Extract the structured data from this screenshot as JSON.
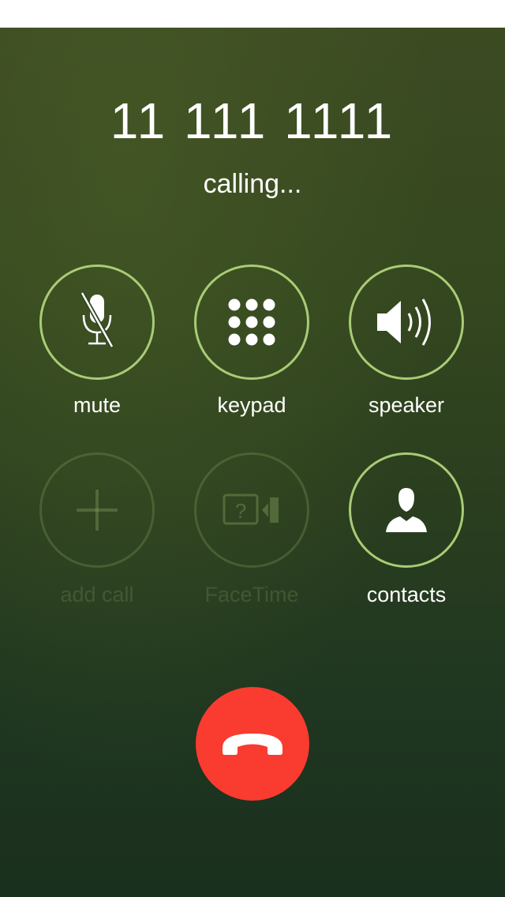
{
  "call": {
    "number": "11 111 1111",
    "status": "calling..."
  },
  "controls": [
    {
      "label": "mute",
      "icon": "muted-microphone-icon",
      "enabled": true
    },
    {
      "label": "keypad",
      "icon": "keypad-icon",
      "enabled": true
    },
    {
      "label": "speaker",
      "icon": "speaker-icon",
      "enabled": true
    },
    {
      "label": "add call",
      "icon": "plus-icon",
      "enabled": false
    },
    {
      "label": "FaceTime",
      "icon": "facetime-icon",
      "enabled": false
    },
    {
      "label": "contacts",
      "icon": "contact-icon",
      "enabled": true
    }
  ],
  "end_call": {
    "icon": "phone-hangup-icon"
  },
  "colors": {
    "ring": "#a9cc75",
    "end_call": "#f93b30",
    "background_top": "#3c4a22",
    "background_bottom": "#1a301e"
  }
}
